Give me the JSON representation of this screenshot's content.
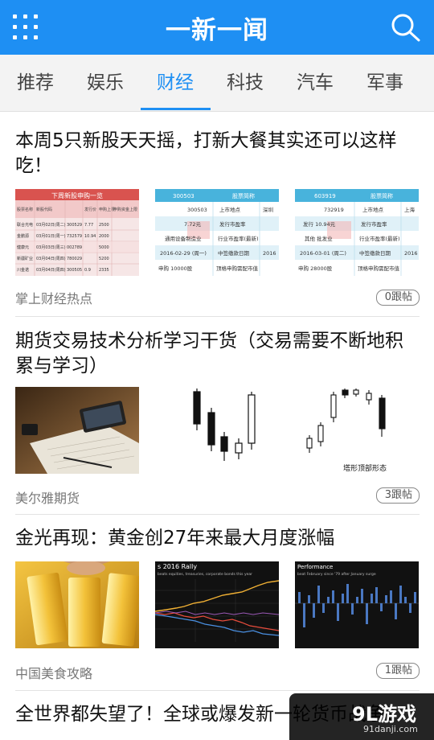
{
  "header": {
    "title": "一新一闻",
    "menu_icon": "grid-menu-icon",
    "search_icon": "search-icon",
    "bg_color": "#1e8ff3"
  },
  "tabs": [
    {
      "label": "推荐",
      "active": false
    },
    {
      "label": "娱乐",
      "active": false
    },
    {
      "label": "财经",
      "active": true
    },
    {
      "label": "科技",
      "active": false
    },
    {
      "label": "汽车",
      "active": false
    },
    {
      "label": "军事",
      "active": false
    }
  ],
  "articles": [
    {
      "title": "本周5只新股天天摇，打新大餐其实还可以这样吃！",
      "images": [
        {
          "kind": "ipo-table",
          "caption": "下周新股申购一览",
          "header_cells": [
            "股票名称",
            "新股代码",
            "发行价",
            "申购上限",
            "申购资金上限"
          ],
          "rows": [
            [
              "联合光电",
              "03月02日(周二)",
              "300529",
              "7.77",
              "2500"
            ],
            [
              "金鹏源",
              "03月01日(周一)",
              "732579",
              "10.94",
              "2000"
            ],
            [
              "健康元",
              "03月03日(周三)",
              "002789",
              "",
              "5000"
            ],
            [
              "新疆矿业",
              "03月04日(周四)",
              "780029",
              "",
              "5200"
            ],
            [
              "川金诺",
              "03月04日(周四)",
              "300505",
              "0.9",
              "2335"
            ]
          ]
        },
        {
          "kind": "stock-card",
          "code": "300503",
          "name_label": "股票简称",
          "rows": [
            [
              "300503",
              "上市地点",
              "深圳"
            ],
            [
              "7.72元",
              "发行市盈率",
              ""
            ],
            [
              "通用设备制造业",
              "行业市盈率(最新)",
              ""
            ],
            [
              "2016-02-29 (周一)",
              "中签缴款日期",
              "2016"
            ],
            [
              "申购 10000股",
              "顶格申购需配市值",
              ""
            ]
          ]
        },
        {
          "kind": "stock-card",
          "code": "603919",
          "name_label": "股票简称",
          "rows": [
            [
              "732919",
              "上市地点",
              "上海"
            ],
            [
              "发行 10.94元",
              "发行市盈率",
              ""
            ],
            [
              "其他 批发业",
              "行业市盈率(最新)",
              ""
            ],
            [
              "2016-03-01 (周二)",
              "中签缴款日期",
              "2016"
            ],
            [
              "申购 28000股",
              "顶格申购需配市值",
              ""
            ]
          ]
        }
      ],
      "source": "掌上财经热点",
      "comments": "0跟帖"
    },
    {
      "title": "期货交易技术分析学习干货（交易需要不断地积累与学习）",
      "images": [
        {
          "kind": "photo-desk"
        },
        {
          "kind": "candlestick-a"
        },
        {
          "kind": "candlestick-b",
          "caption": "塔形顶部形态"
        }
      ],
      "source": "美尔雅期货",
      "comments": "3跟帖"
    },
    {
      "title": "金光再现：黄金创27年来最大月度涨幅",
      "images": [
        {
          "kind": "photo-gold"
        },
        {
          "kind": "line-chart",
          "caption": "s 2016 Rally",
          "subtitle": "beats equities, treasuries, corporate bonds this year"
        },
        {
          "kind": "bar-chart",
          "caption": "Performance",
          "subtitle": "beat February since '79 after January surge"
        }
      ],
      "source": "中国美食攻略",
      "comments": "1跟帖"
    },
    {
      "title": "全世界都失望了！全球或爆发新一轮货币战争！"
    }
  ],
  "watermark": {
    "logo": "9L游戏",
    "url": "91danji.com"
  }
}
